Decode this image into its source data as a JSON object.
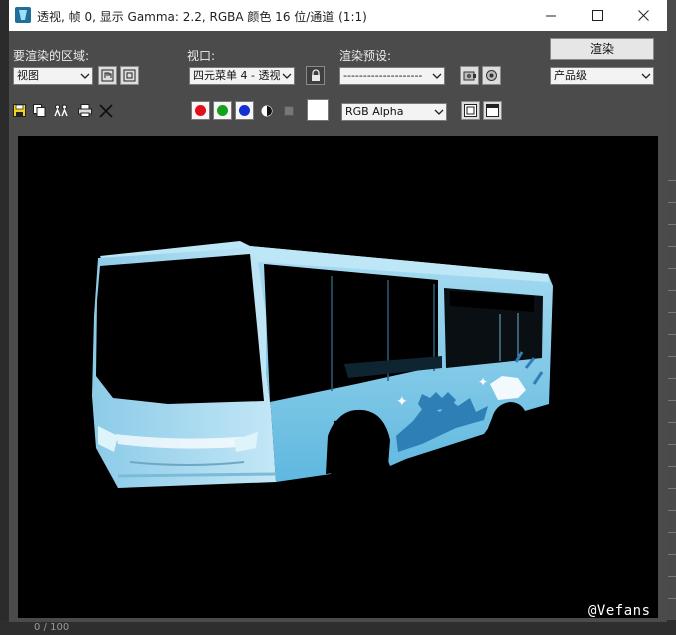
{
  "window": {
    "title": "透视, 帧 0, 显示 Gamma: 2.2, RGBA 颜色 16 位/通道 (1:1)"
  },
  "area_label": "要渲染的区域:",
  "area_value": "视图",
  "viewport_label": "视口:",
  "viewport_value": "四元菜单 4 - 透视",
  "preset_label": "渲染预设:",
  "preset_value": "--------------------",
  "render_button": "渲染",
  "quality_value": "产品级",
  "channel_value": "RGB Alpha",
  "channel_colors": {
    "red": "#e0101a",
    "green": "#17a11a",
    "blue": "#1530d0"
  },
  "frame_counter": "0 / 100",
  "watermark": "@Vefans",
  "icons": {
    "app": "3dsmax-app-icon",
    "save": "save-icon",
    "copy": "copy-image-icon",
    "clone": "clone-window-icon",
    "print": "print-icon",
    "clear": "clear-icon",
    "lock": "lock-icon",
    "mono": "monochrome-icon",
    "bg": "background-swatch-icon"
  }
}
